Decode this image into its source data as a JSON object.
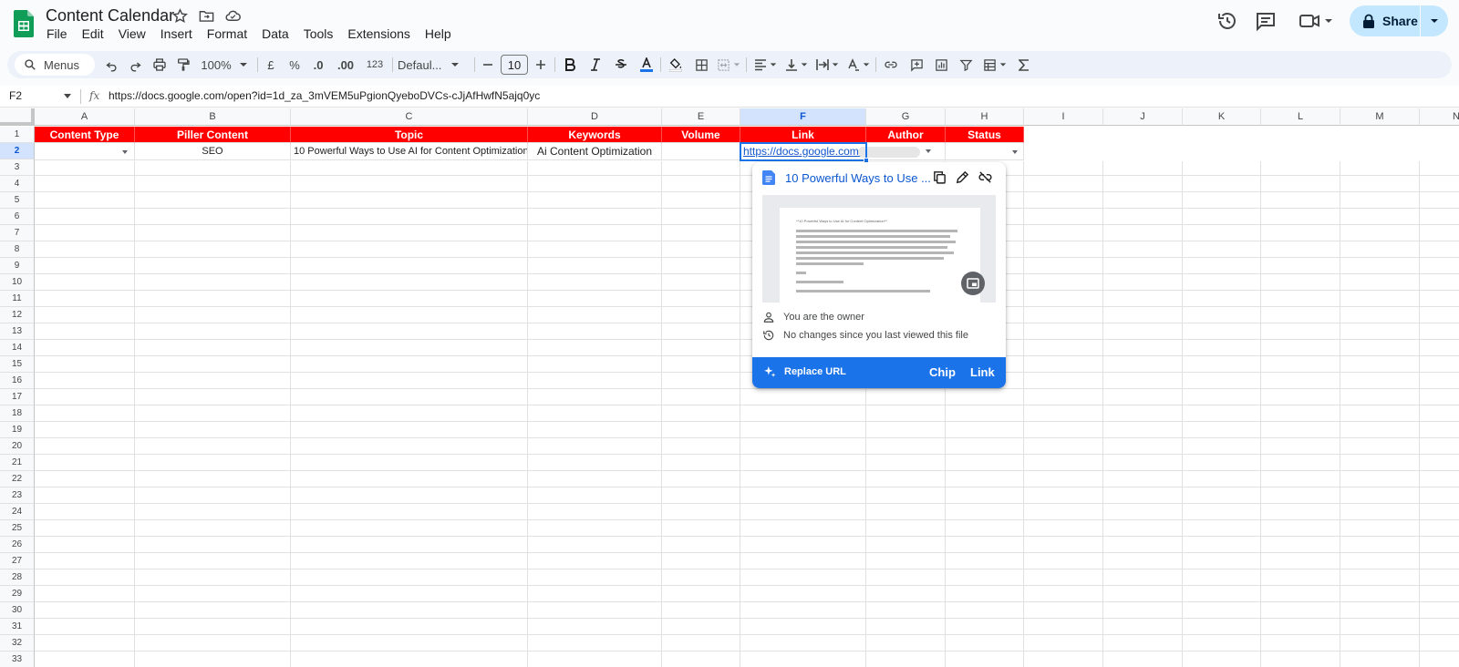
{
  "app": {
    "title": "Content Calendar",
    "menu": [
      "File",
      "Edit",
      "View",
      "Insert",
      "Format",
      "Data",
      "Tools",
      "Extensions",
      "Help"
    ],
    "share_label": "Share"
  },
  "toolbar": {
    "menus_label": "Menus",
    "zoom": "100%",
    "currency": "£",
    "percent": "%",
    "dec_decrease": ".0",
    "dec_increase": ".00",
    "number_format": "123",
    "font": "Defaul...",
    "font_size": "10"
  },
  "formula_bar": {
    "cell_ref": "F2",
    "fx": "fx",
    "content": "https://docs.google.com/open?id=1d_za_3mVEM5uPgionQyeboDVCs-cJjAfHwfN5ajq0yc"
  },
  "columns": [
    "A",
    "B",
    "C",
    "D",
    "E",
    "F",
    "G",
    "H",
    "I",
    "J",
    "K",
    "L",
    "M",
    "N"
  ],
  "selected_column": "F",
  "rows": [
    "1",
    "2",
    "3",
    "4",
    "5",
    "6",
    "7",
    "8",
    "9",
    "10",
    "11",
    "12",
    "13",
    "14",
    "15",
    "16",
    "17",
    "18",
    "19",
    "20",
    "21",
    "22",
    "23",
    "24",
    "25",
    "26",
    "27",
    "28",
    "29",
    "30",
    "31",
    "32",
    "33"
  ],
  "selected_row": "2",
  "header_row": [
    "Content Type",
    "Piller Content",
    "Topic",
    "Keywords",
    "Volume",
    "Link",
    "Author",
    "Status"
  ],
  "data_row": {
    "content_type": "",
    "piller_content": "SEO",
    "topic": "10 Powerful Ways to Use AI for Content Optimization",
    "keywords": "Ai Content Optimization",
    "volume": "",
    "link": "https://docs.google.com/open?id=1d_za_3mVEM5uPgionQyeboDVCs-cJjAfHwfN5ajq0yc",
    "author": "",
    "status": ""
  },
  "popup": {
    "title": "10 Powerful Ways to Use ...",
    "preview_heading": "**10 Powerful Ways to Use AI for Content Optimization**",
    "owner_text": "You are the owner",
    "changes_text": "No changes since you last viewed this file",
    "replace_label": "Replace URL",
    "chip_label": "Chip",
    "link_label": "Link"
  },
  "colors": {
    "header_fill": "#ff0000",
    "accent": "#1a73e8",
    "share_bg": "#c2e7ff",
    "sheets_green": "#0f9d58"
  }
}
